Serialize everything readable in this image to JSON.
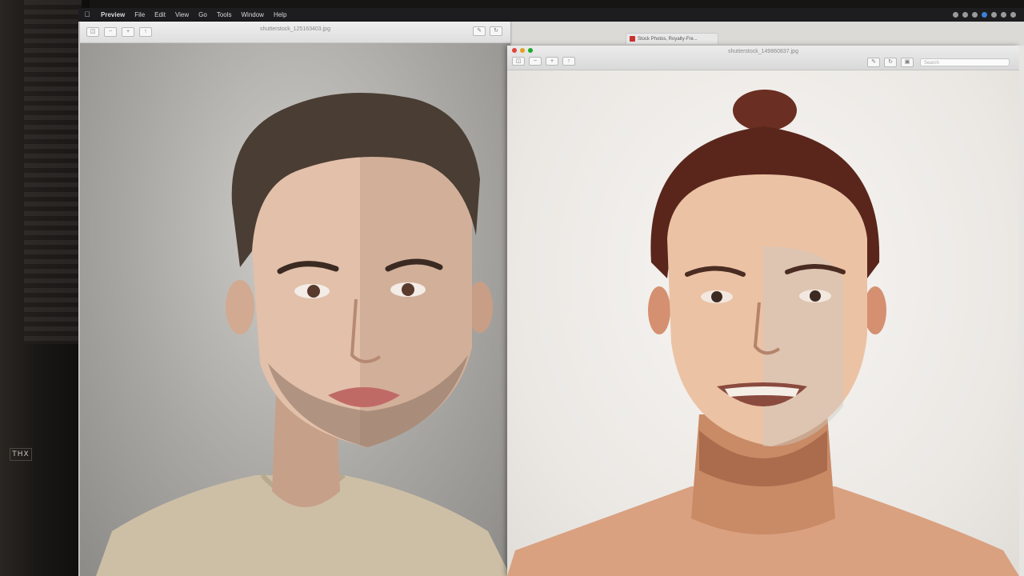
{
  "menubar": {
    "app_name": "Preview",
    "items": [
      "File",
      "Edit",
      "View",
      "Go",
      "Tools",
      "Window",
      "Help"
    ]
  },
  "window_left": {
    "title": "shutterstock_125163403.jpg"
  },
  "window_right": {
    "title": "shutterstock_149860837.jpg",
    "search_placeholder": "Search"
  },
  "browser_tab": {
    "label": "Stock Photos, Royalty-Fre..."
  },
  "bezel": {
    "badge": "THX"
  }
}
